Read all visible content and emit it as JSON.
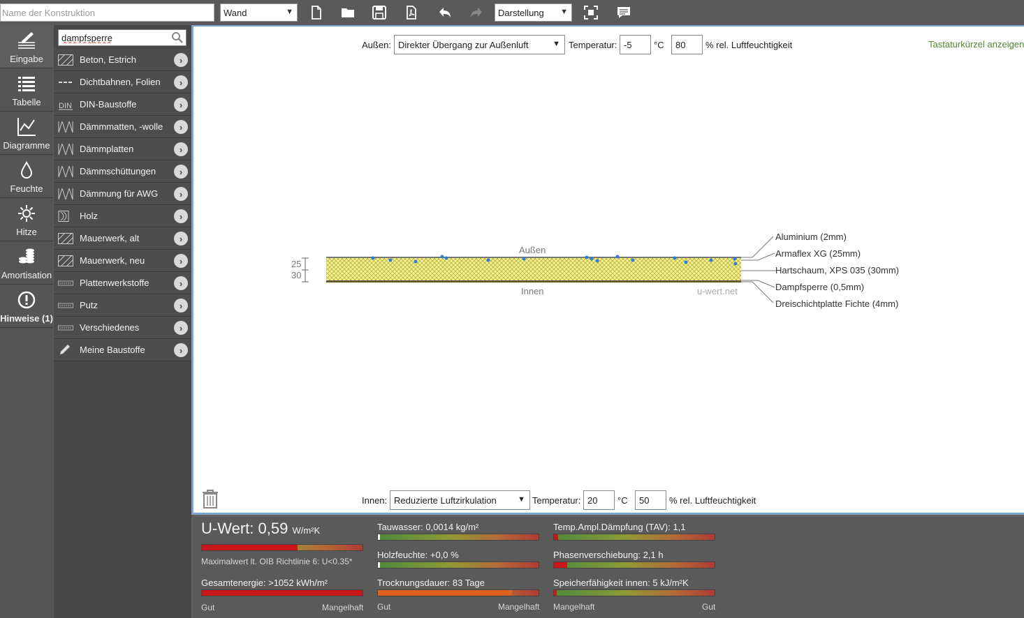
{
  "toolbar": {
    "name_placeholder": "Name der Konstruktion",
    "type_select": "Wand",
    "view_select": "Darstellung",
    "icons": [
      "new-file-icon",
      "open-folder-icon",
      "save-icon",
      "pdf-icon",
      "undo-icon",
      "redo-icon",
      "fullscreen-icon",
      "feedback-icon"
    ]
  },
  "nav": {
    "items": [
      {
        "label": "Eingabe",
        "icon": "pencil-layers-icon"
      },
      {
        "label": "Tabelle",
        "icon": "table-icon"
      },
      {
        "label": "Diagramme",
        "icon": "chart-icon"
      },
      {
        "label": "Feuchte",
        "icon": "drop-icon"
      },
      {
        "label": "Hitze",
        "icon": "sun-icon"
      },
      {
        "label": "Amortisation",
        "icon": "coins-icon"
      },
      {
        "label": "Hinweise (1)",
        "icon": "warning-icon"
      }
    ]
  },
  "materials": {
    "search_value": "dampfsperre",
    "items": [
      {
        "label": "Beton, Estrich",
        "icon": "hatch-icon"
      },
      {
        "label": "Dichtbahnen, Folien",
        "icon": "membrane-icon"
      },
      {
        "label": "DIN-Baustoffe",
        "icon": "din-icon"
      },
      {
        "label": "Dämmmatten, -wolle",
        "icon": "insulation-icon"
      },
      {
        "label": "Dämmplatten",
        "icon": "insulation-icon"
      },
      {
        "label": "Dämmschüttungen",
        "icon": "insulation-icon"
      },
      {
        "label": "Dämmung für AWG",
        "icon": "insulation-icon"
      },
      {
        "label": "Holz",
        "icon": "wood-icon"
      },
      {
        "label": "Mauerwerk, alt",
        "icon": "hatch-icon"
      },
      {
        "label": "Mauerwerk, neu",
        "icon": "hatch-icon"
      },
      {
        "label": "Plattenwerkstoffe",
        "icon": "board-icon"
      },
      {
        "label": "Putz",
        "icon": "board-icon"
      },
      {
        "label": "Verschiedenes",
        "icon": "board-icon"
      },
      {
        "label": "Meine Baustoffe",
        "icon": "pencil-icon"
      }
    ]
  },
  "outside": {
    "label": "Außen:",
    "condition": "Direkter Übergang zur Außenluft",
    "temp_label": "Temperatur:",
    "temp": "-5",
    "temp_unit": "°C",
    "humidity": "80",
    "humidity_label": "% rel. Luftfeuchtigkeit"
  },
  "inside": {
    "label": "Innen:",
    "condition": "Reduzierte Luftzirkulation",
    "temp_label": "Temperatur:",
    "temp": "20",
    "temp_unit": "°C",
    "humidity": "50",
    "humidity_label": "% rel. Luftfeuchtigkeit"
  },
  "shortcuts_link": "Tastaturkürzel anzeigen",
  "diagram": {
    "outside_label": "Außen",
    "inside_label": "Innen",
    "watermark": "u-wert.net",
    "dim_top": "25",
    "dim_bottom": "30",
    "layers": [
      "Aluminium (2mm)",
      "Armaflex XG (25mm)",
      "Hartschaum, XPS 035 (30mm)",
      "Dampfsperre (0,5mm)",
      "Dreischichtplatte Fichte (4mm)"
    ]
  },
  "stats": {
    "uwert_label": "U-Wert:",
    "uwert_value": "0,59",
    "uwert_unit": "W/m²K",
    "uwert_note": "Maximalwert lt. OIB Richtlinie 6: U<0.35*",
    "uwert_level": 0.59,
    "energy": "Gesamtenergie: >1052 kWh/m²",
    "tauwasser": "Tauwasser: 0,0014 kg/m²",
    "holzfeuchte": "Holzfeuchte: +0,0 %",
    "trocknung": "Trocknungsdauer: 83 Tage",
    "tav": "Temp.Ampl.Dämpfung (TAV): 1,1",
    "phasen": "Phasenverschiebung: 2,1 h",
    "speicher": "Speicherfähigkeit innen: 5 kJ/m²K",
    "col1_left": "Gut",
    "col1_right": "Mangelhaft",
    "col2_left": "Gut",
    "col2_right": "Mangelhaft",
    "col3_left": "Mangelhaft",
    "col3_right": "Gut"
  }
}
